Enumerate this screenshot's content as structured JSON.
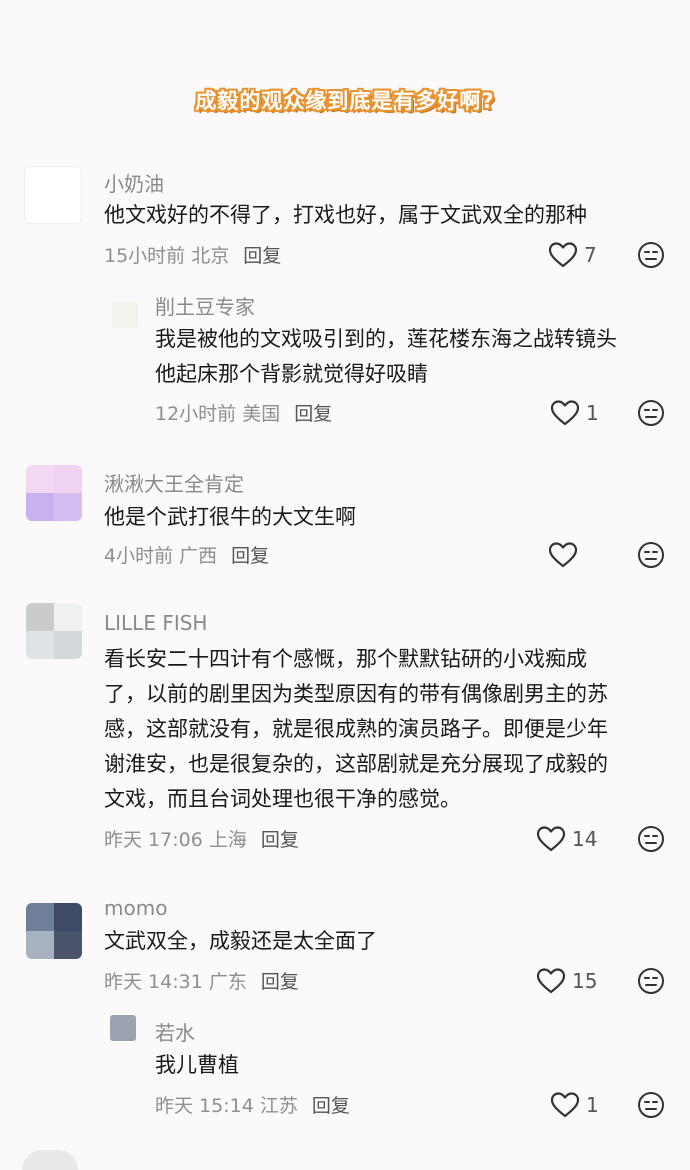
{
  "header": {
    "title": "成毅的观众缘到底是有多好啊?"
  },
  "comments": [
    {
      "user": "小奶油",
      "lines": [
        "他文戏好的不得了，打戏也好，属于文武双全的那种"
      ],
      "time": "15小时前 北京",
      "reply": "回复",
      "likes": "7"
    },
    {
      "user": "削土豆专家",
      "lines": [
        "我是被他的文戏吸引到的，莲花楼东海之战转镜头",
        "他起床那个背影就觉得好吸睛"
      ],
      "time": "12小时前 美国",
      "reply": "回复",
      "likes": "1"
    },
    {
      "user": "湫湫大王全肯定",
      "lines": [
        "他是个武打很牛的大文生啊"
      ],
      "time": "4小时前 广西",
      "reply": "回复",
      "likes": ""
    },
    {
      "user": "LILLE FISH",
      "lines": [
        "看长安二十四计有个感慨，那个默默钻研的小戏痴成",
        "了，以前的剧里因为类型原因有的带有偶像剧男主的苏",
        "感，这部就没有，就是很成熟的演员路子。即便是少年",
        "谢淮安，也是很复杂的，这部剧就是充分展现了成毅的",
        "文戏，而且台词处理也很干净的感觉。"
      ],
      "time": "昨天 17:06 上海",
      "reply": "回复",
      "likes": "14"
    },
    {
      "user": "momo",
      "lines": [
        "文武双全，成毅还是太全面了"
      ],
      "time": "昨天 14:31 广东",
      "reply": "回复",
      "likes": "15"
    },
    {
      "user": "若水",
      "lines": [
        "我儿曹植"
      ],
      "time": "昨天 15:14 江苏",
      "reply": "回复",
      "likes": "1"
    }
  ],
  "icons": {
    "like": "heart-outline-icon",
    "dislike": "meh-face-icon"
  }
}
